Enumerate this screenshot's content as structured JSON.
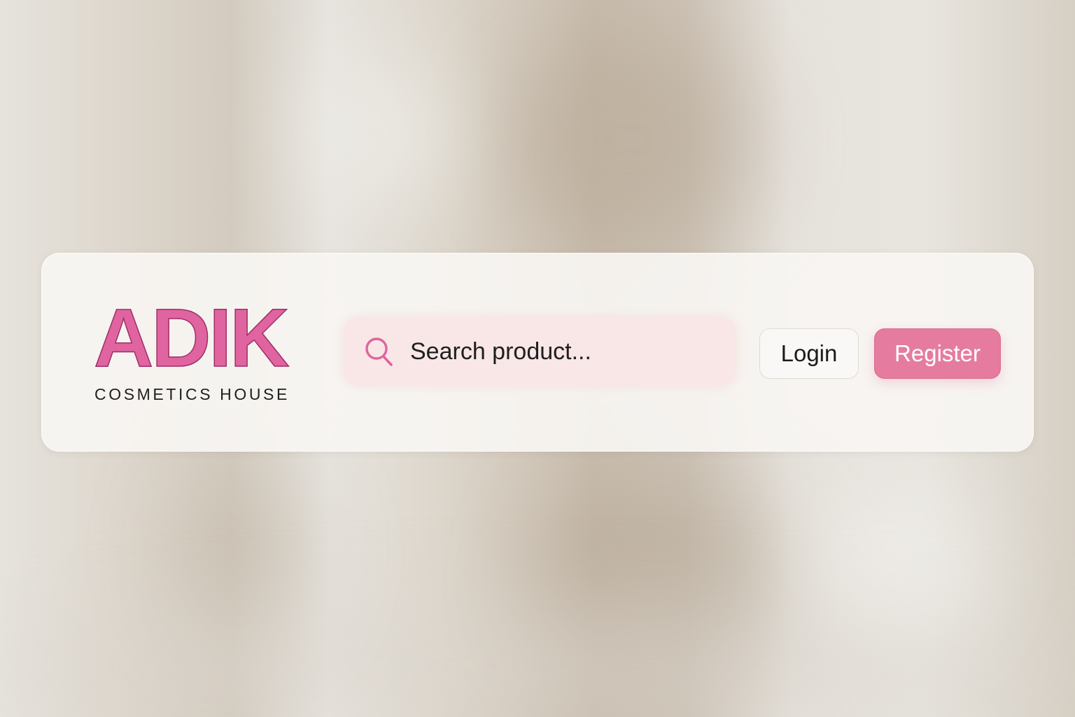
{
  "header": {
    "logo": {
      "wordmark": "ADIK",
      "tagline": "COSMETICS HOUSE"
    },
    "search": {
      "placeholder": "Search product...",
      "value": "",
      "icon": "search-icon"
    },
    "actions": {
      "login_label": "Login",
      "register_label": "Register"
    }
  },
  "colors": {
    "brand_pink": "#e0649f",
    "register_button": "#e57c9f",
    "search_background": "#f8e7e6",
    "header_background": "#f7f5f2"
  }
}
